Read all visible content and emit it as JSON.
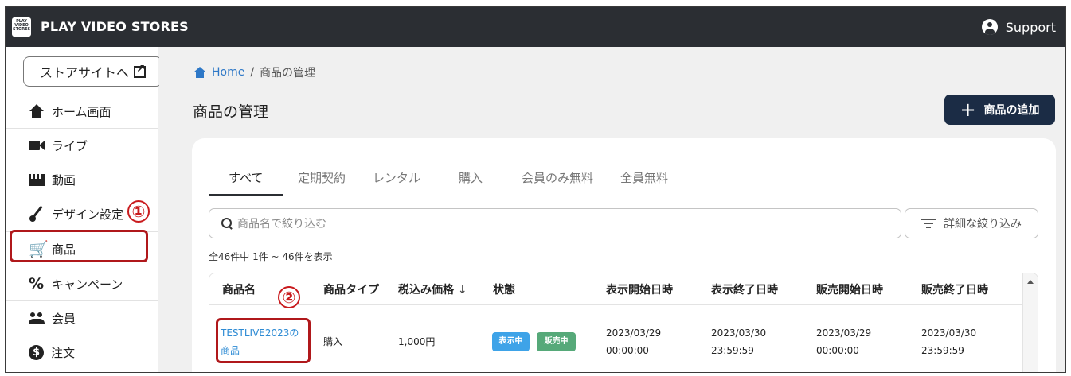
{
  "header": {
    "brand": "PLAY VIDEO STORES",
    "logo_text": "PLAY VIDEO STORES",
    "support_label": "Support"
  },
  "sidebar": {
    "store_button": "ストアサイトへ",
    "items": [
      {
        "label": "ホーム画面",
        "icon": "home-icon"
      },
      {
        "label": "ライブ",
        "icon": "video-camera-icon"
      },
      {
        "label": "動画",
        "icon": "movie-icon"
      },
      {
        "label": "デザイン設定",
        "icon": "brush-icon"
      },
      {
        "label": "商品",
        "icon": "cart-icon"
      },
      {
        "label": "キャンペーン",
        "icon": "percent-icon"
      },
      {
        "label": "会員",
        "icon": "people-icon"
      },
      {
        "label": "注文",
        "icon": "dollar-icon"
      }
    ]
  },
  "annotations": {
    "marker_1": "①",
    "marker_2": "②",
    "highlight_color": "#b0181b"
  },
  "breadcrumb": {
    "home": "Home",
    "separator": "/",
    "current": "商品の管理"
  },
  "page": {
    "title": "商品の管理",
    "add_button": "商品の追加",
    "add_symbol": "+"
  },
  "tabs": [
    "すべて",
    "定期契約",
    "レンタル",
    "購入",
    "会員のみ無料",
    "全員無料"
  ],
  "search": {
    "placeholder": "商品名で絞り込む",
    "filter_button": "詳細な絞り込み"
  },
  "result_count": "全46件中 1件 ~ 46件を表示",
  "table": {
    "headers": [
      "商品名",
      "商品タイプ",
      "税込み価格",
      "状態",
      "表示開始日時",
      "表示終了日時",
      "販売開始日時",
      "販売終了日時"
    ],
    "sort_indicator": "↓",
    "rows": [
      {
        "name_line1": "TESTLIVE2023の",
        "name_line2": "商品",
        "type": "購入",
        "price": "1,000円",
        "badges": [
          {
            "label": "表示中",
            "color": "#3ea3e8"
          },
          {
            "label": "販売中",
            "color": "#56a979"
          }
        ],
        "display_start_date": "2023/03/29",
        "display_start_time": "00:00:00",
        "display_end_date": "2023/03/30",
        "display_end_time": "23:59:59",
        "sale_start_date": "2023/03/29",
        "sale_start_time": "00:00:00",
        "sale_end_date": "2023/03/30",
        "sale_end_time": "23:59:59"
      }
    ]
  },
  "colors": {
    "topbar": "#2b2e33",
    "primary_button": "#1b2c45",
    "link": "#2e78c7"
  }
}
